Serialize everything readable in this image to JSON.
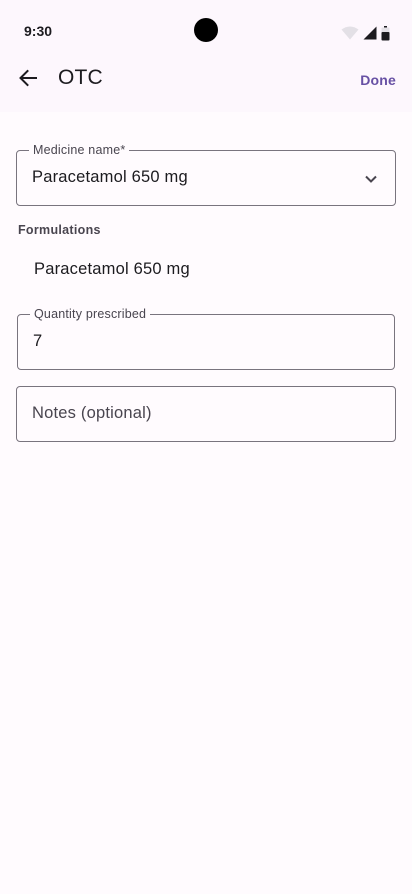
{
  "status_bar": {
    "time": "9:30",
    "icons": [
      "wifi-icon",
      "cellular-signal-icon",
      "battery-icon"
    ]
  },
  "app_bar": {
    "title": "OTC",
    "done_label": "Done",
    "back_icon": "arrow-back-icon"
  },
  "medicine_name": {
    "label": "Medicine name*",
    "value": "Paracetamol 650 mg",
    "icon": "chevron-down-icon"
  },
  "formulations": {
    "label": "Formulations",
    "items": [
      "Paracetamol 650 mg"
    ]
  },
  "quantity": {
    "label": "Quantity prescribed",
    "value": "7"
  },
  "notes": {
    "placeholder": "Notes (optional)",
    "value": ""
  },
  "colors": {
    "accent": "#6750a4",
    "outline": "#79747e",
    "background": "#fffbfe"
  }
}
